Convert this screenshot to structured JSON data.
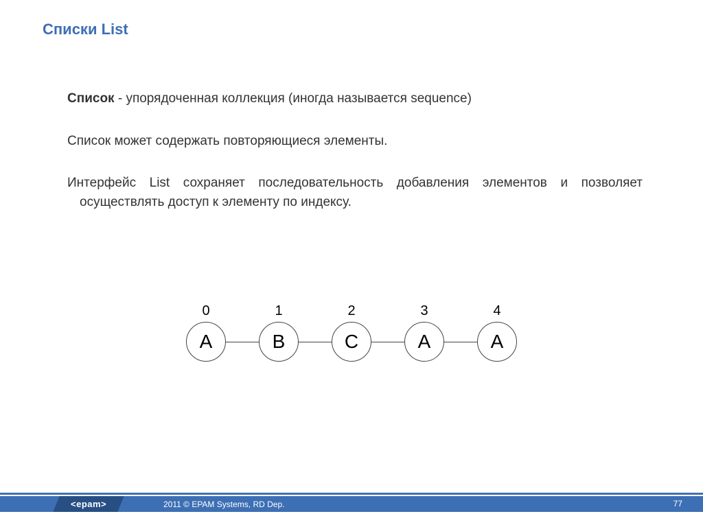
{
  "title": "Списки List",
  "body": {
    "p1_lead": "Список",
    "p1_rest": " - упорядоченная коллекция (иногда называется sequence)",
    "p2": "Список может содержать повторяющиеся элементы.",
    "p3": "Интерфейс List сохраняет последовательность добавления элементов и позволяет осуществлять доступ к элементу по индексу."
  },
  "diagram": {
    "nodes": [
      {
        "index": "0",
        "label": "A"
      },
      {
        "index": "1",
        "label": "B"
      },
      {
        "index": "2",
        "label": "C"
      },
      {
        "index": "3",
        "label": "A"
      },
      {
        "index": "4",
        "label": "A"
      }
    ]
  },
  "footer": {
    "logo": "<epam>",
    "copyright": "2011 © EPAM Systems, RD Dep.",
    "page": "77"
  }
}
